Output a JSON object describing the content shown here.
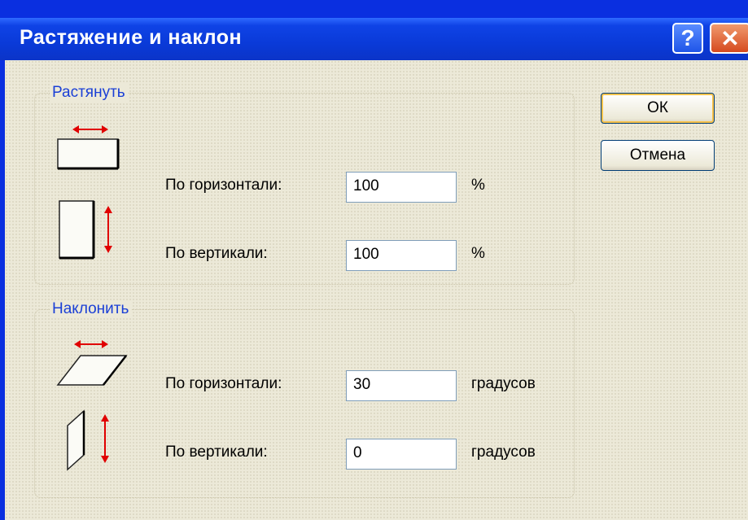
{
  "window": {
    "title": "Растяжение и наклон",
    "help_label": "?",
    "close_label": "✕"
  },
  "stretch": {
    "label": "Растянуть",
    "horizontal": {
      "label": "По горизонтали:",
      "value": "100",
      "unit": "%"
    },
    "vertical": {
      "label": "По вертикали:",
      "value": "100",
      "unit": "%"
    }
  },
  "skew": {
    "label": "Наклонить",
    "horizontal": {
      "label": "По горизонтали:",
      "value": "30",
      "unit": "градусов"
    },
    "vertical": {
      "label": "По вертикали:",
      "value": "0",
      "unit": "градусов"
    }
  },
  "buttons": {
    "ok": "ОК",
    "cancel": "Отмена"
  },
  "icons": {
    "stretch_horizontal": "stretch-horizontal-icon",
    "stretch_vertical": "stretch-vertical-icon",
    "skew_horizontal": "skew-horizontal-icon",
    "skew_vertical": "skew-vertical-icon"
  },
  "colors": {
    "title_bar": "#0a3ad8",
    "dialog_bg": "#ece9d8",
    "group_label": "#1a3fd6",
    "arrow": "#e00000"
  }
}
